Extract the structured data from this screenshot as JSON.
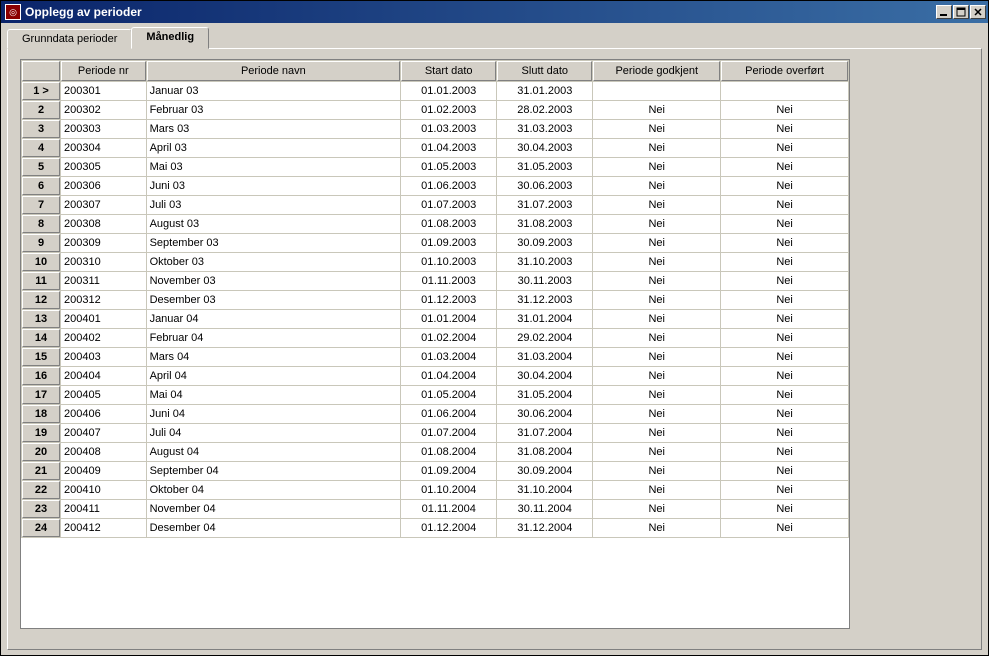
{
  "titlebar": {
    "title": "Opplegg av perioder"
  },
  "tabs": {
    "grunndata": "Grunndata perioder",
    "manedlig": "Månedlig"
  },
  "grid": {
    "headers": {
      "periode_nr": "Periode nr",
      "periode_navn": "Periode navn",
      "start_dato": "Start dato",
      "slutt_dato": "Slutt dato",
      "godkjent": "Periode godkjent",
      "overfort": "Periode overført"
    },
    "rows": [
      {
        "idx": "1 >",
        "nr": "200301",
        "navn": "Januar 03",
        "start": "01.01.2003",
        "slutt": "31.01.2003",
        "godk": "",
        "over": ""
      },
      {
        "idx": "2",
        "nr": "200302",
        "navn": "Februar 03",
        "start": "01.02.2003",
        "slutt": "28.02.2003",
        "godk": "Nei",
        "over": "Nei"
      },
      {
        "idx": "3",
        "nr": "200303",
        "navn": "Mars 03",
        "start": "01.03.2003",
        "slutt": "31.03.2003",
        "godk": "Nei",
        "over": "Nei"
      },
      {
        "idx": "4",
        "nr": "200304",
        "navn": "April 03",
        "start": "01.04.2003",
        "slutt": "30.04.2003",
        "godk": "Nei",
        "over": "Nei"
      },
      {
        "idx": "5",
        "nr": "200305",
        "navn": "Mai 03",
        "start": "01.05.2003",
        "slutt": "31.05.2003",
        "godk": "Nei",
        "over": "Nei"
      },
      {
        "idx": "6",
        "nr": "200306",
        "navn": "Juni 03",
        "start": "01.06.2003",
        "slutt": "30.06.2003",
        "godk": "Nei",
        "over": "Nei"
      },
      {
        "idx": "7",
        "nr": "200307",
        "navn": "Juli 03",
        "start": "01.07.2003",
        "slutt": "31.07.2003",
        "godk": "Nei",
        "over": "Nei"
      },
      {
        "idx": "8",
        "nr": "200308",
        "navn": "August 03",
        "start": "01.08.2003",
        "slutt": "31.08.2003",
        "godk": "Nei",
        "over": "Nei"
      },
      {
        "idx": "9",
        "nr": "200309",
        "navn": "September 03",
        "start": "01.09.2003",
        "slutt": "30.09.2003",
        "godk": "Nei",
        "over": "Nei"
      },
      {
        "idx": "10",
        "nr": "200310",
        "navn": "Oktober 03",
        "start": "01.10.2003",
        "slutt": "31.10.2003",
        "godk": "Nei",
        "over": "Nei"
      },
      {
        "idx": "11",
        "nr": "200311",
        "navn": "November 03",
        "start": "01.11.2003",
        "slutt": "30.11.2003",
        "godk": "Nei",
        "over": "Nei"
      },
      {
        "idx": "12",
        "nr": "200312",
        "navn": "Desember 03",
        "start": "01.12.2003",
        "slutt": "31.12.2003",
        "godk": "Nei",
        "over": "Nei"
      },
      {
        "idx": "13",
        "nr": "200401",
        "navn": "Januar 04",
        "start": "01.01.2004",
        "slutt": "31.01.2004",
        "godk": "Nei",
        "over": "Nei"
      },
      {
        "idx": "14",
        "nr": "200402",
        "navn": "Februar 04",
        "start": "01.02.2004",
        "slutt": "29.02.2004",
        "godk": "Nei",
        "over": "Nei"
      },
      {
        "idx": "15",
        "nr": "200403",
        "navn": "Mars 04",
        "start": "01.03.2004",
        "slutt": "31.03.2004",
        "godk": "Nei",
        "over": "Nei"
      },
      {
        "idx": "16",
        "nr": "200404",
        "navn": "April 04",
        "start": "01.04.2004",
        "slutt": "30.04.2004",
        "godk": "Nei",
        "over": "Nei"
      },
      {
        "idx": "17",
        "nr": "200405",
        "navn": "Mai 04",
        "start": "01.05.2004",
        "slutt": "31.05.2004",
        "godk": "Nei",
        "over": "Nei"
      },
      {
        "idx": "18",
        "nr": "200406",
        "navn": "Juni 04",
        "start": "01.06.2004",
        "slutt": "30.06.2004",
        "godk": "Nei",
        "over": "Nei"
      },
      {
        "idx": "19",
        "nr": "200407",
        "navn": "Juli 04",
        "start": "01.07.2004",
        "slutt": "31.07.2004",
        "godk": "Nei",
        "over": "Nei"
      },
      {
        "idx": "20",
        "nr": "200408",
        "navn": "August 04",
        "start": "01.08.2004",
        "slutt": "31.08.2004",
        "godk": "Nei",
        "over": "Nei"
      },
      {
        "idx": "21",
        "nr": "200409",
        "navn": "September 04",
        "start": "01.09.2004",
        "slutt": "30.09.2004",
        "godk": "Nei",
        "over": "Nei"
      },
      {
        "idx": "22",
        "nr": "200410",
        "navn": "Oktober 04",
        "start": "01.10.2004",
        "slutt": "31.10.2004",
        "godk": "Nei",
        "over": "Nei"
      },
      {
        "idx": "23",
        "nr": "200411",
        "navn": "November 04",
        "start": "01.11.2004",
        "slutt": "30.11.2004",
        "godk": "Nei",
        "over": "Nei"
      },
      {
        "idx": "24",
        "nr": "200412",
        "navn": "Desember 04",
        "start": "01.12.2004",
        "slutt": "31.12.2004",
        "godk": "Nei",
        "over": "Nei"
      }
    ]
  }
}
